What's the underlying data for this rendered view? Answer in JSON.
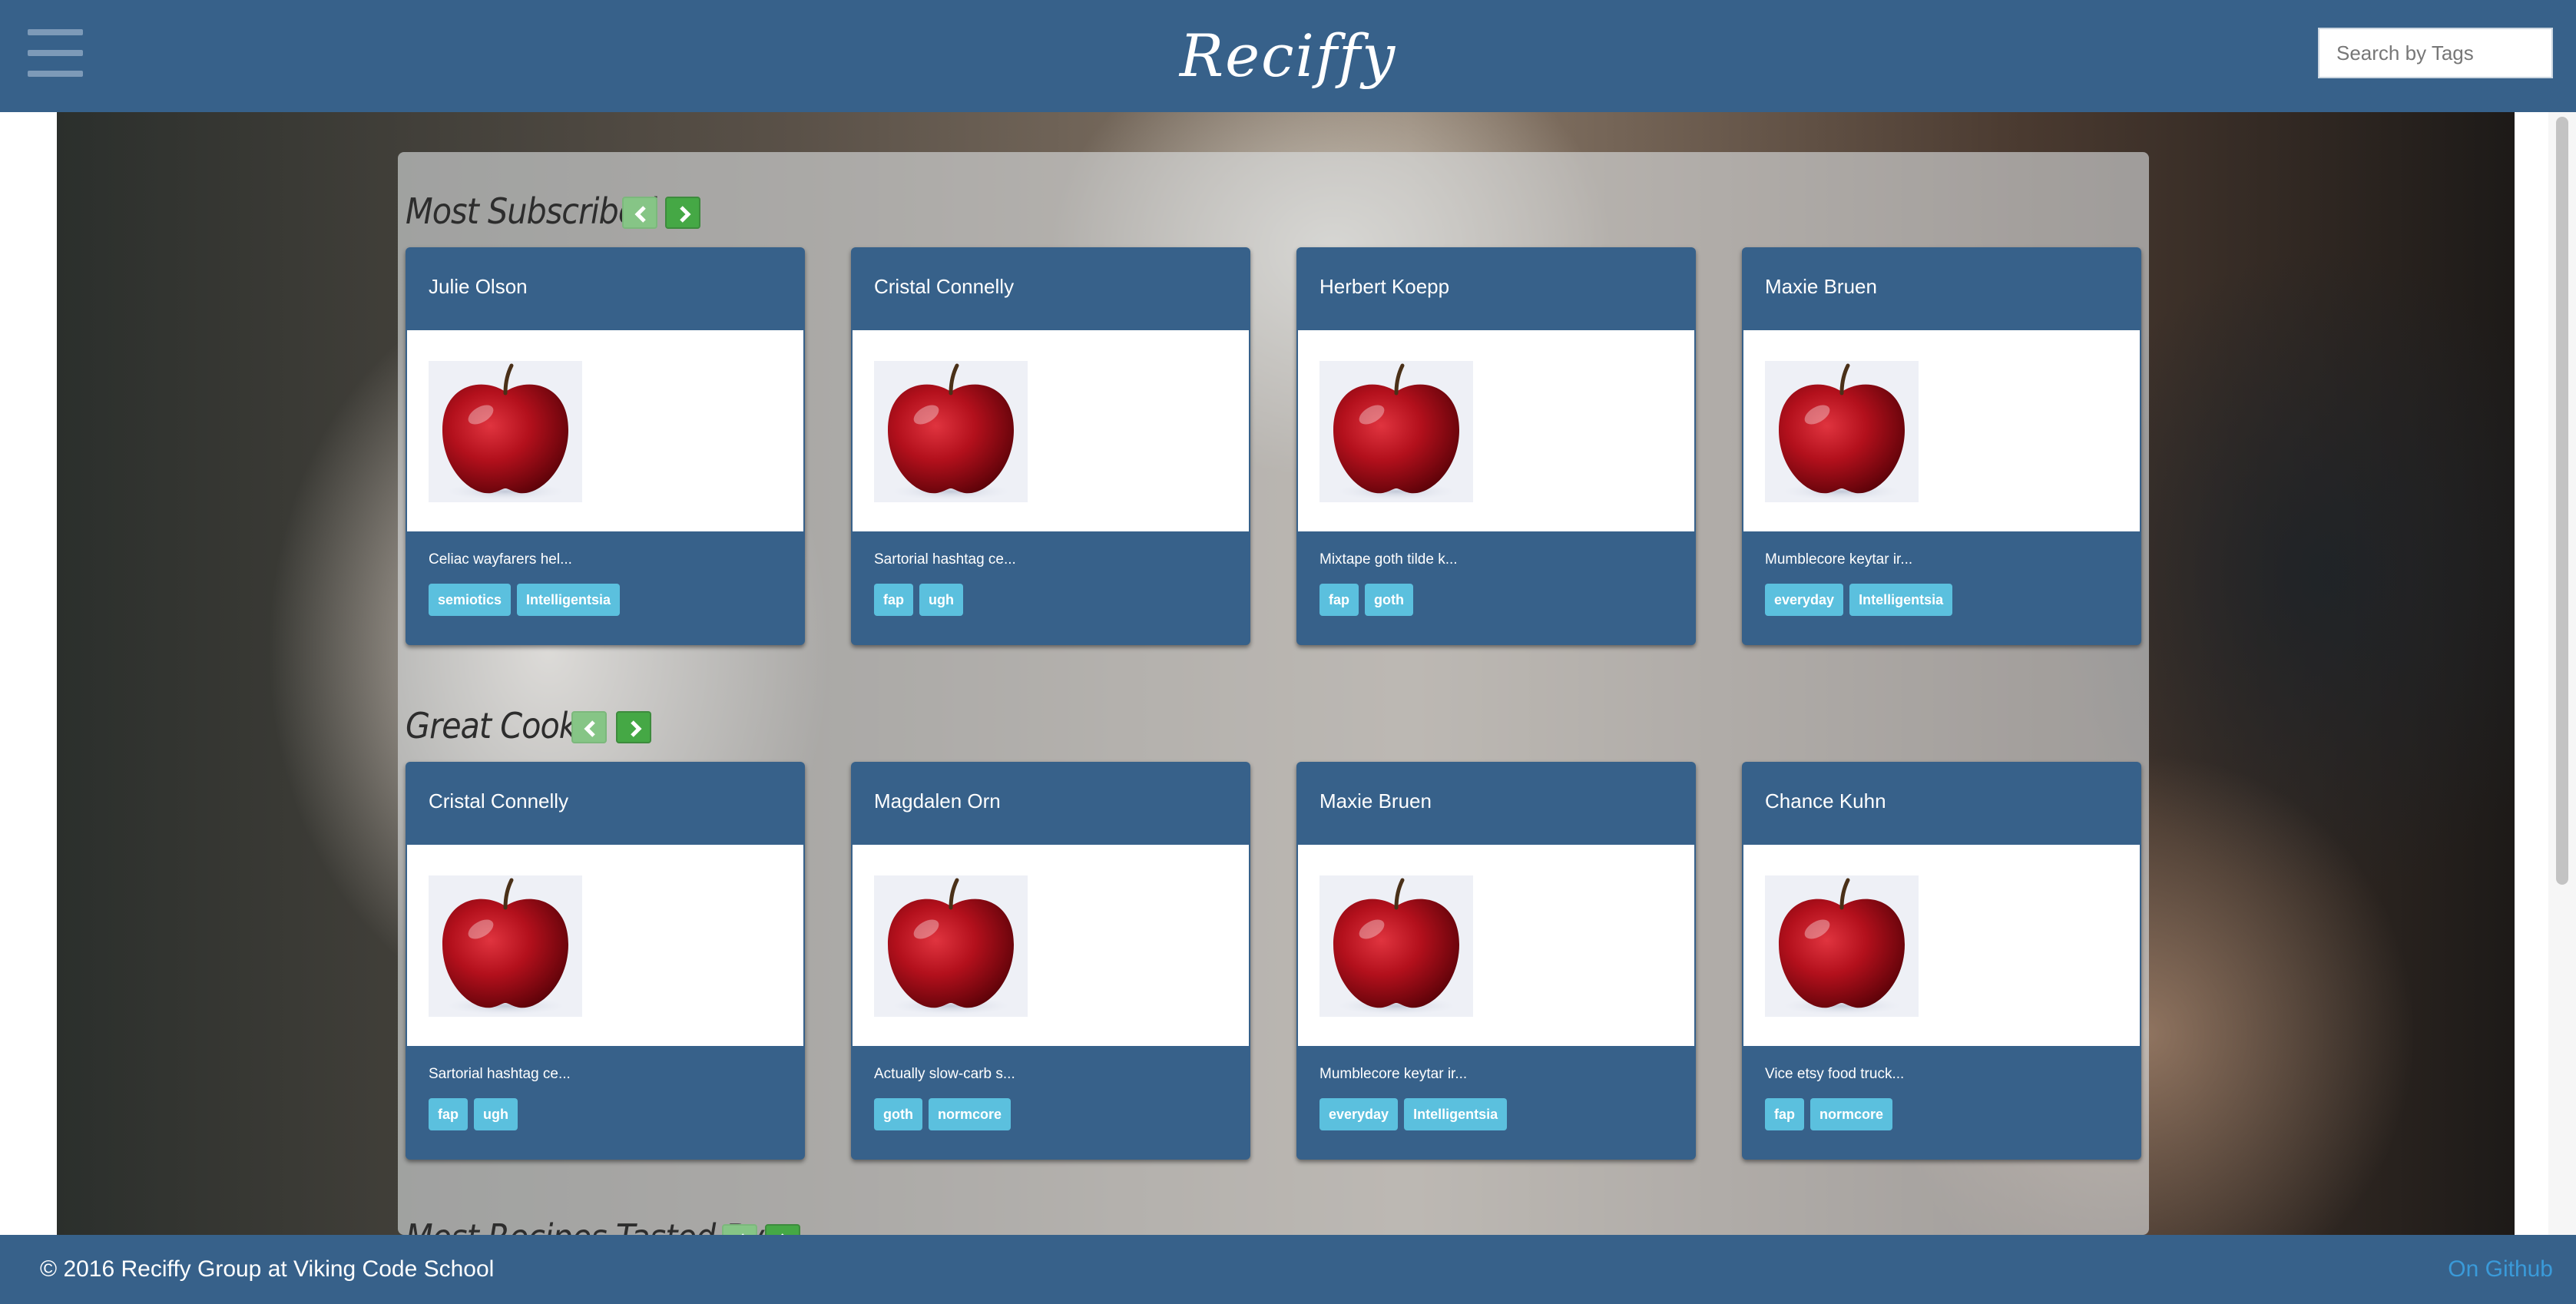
{
  "header": {
    "brand": "Reciffy",
    "search_placeholder": "Search by Tags"
  },
  "sections": [
    {
      "title": "Most Subscribed",
      "cards": [
        {
          "name": "Julie Olson",
          "description": "Celiac wayfarers hel...",
          "tags": [
            "semiotics",
            "Intelligentsia"
          ]
        },
        {
          "name": "Cristal Connelly",
          "description": "Sartorial hashtag ce...",
          "tags": [
            "fap",
            "ugh"
          ]
        },
        {
          "name": "Herbert Koepp",
          "description": "Mixtape goth tilde k...",
          "tags": [
            "fap",
            "goth"
          ]
        },
        {
          "name": "Maxie Bruen",
          "description": "Mumblecore keytar ir...",
          "tags": [
            "everyday",
            "Intelligentsia"
          ]
        }
      ]
    },
    {
      "title": "Great Cooks!",
      "cards": [
        {
          "name": "Cristal Connelly",
          "description": "Sartorial hashtag ce...",
          "tags": [
            "fap",
            "ugh"
          ]
        },
        {
          "name": "Magdalen Orn",
          "description": "Actually slow-carb s...",
          "tags": [
            "goth",
            "normcore"
          ]
        },
        {
          "name": "Maxie Bruen",
          "description": "Mumblecore keytar ir...",
          "tags": [
            "everyday",
            "Intelligentsia"
          ]
        },
        {
          "name": "Chance Kuhn",
          "description": "Vice etsy food truck...",
          "tags": [
            "fap",
            "normcore"
          ]
        }
      ]
    },
    {
      "title": "Most Recipes Tasted By"
    }
  ],
  "footer": {
    "copyright": "© 2016 Reciffy Group at Viking Code School",
    "github_link": "On Github"
  },
  "icons": {
    "menu": "hamburger-icon",
    "prev": "chevron-left-icon",
    "next": "chevron-right-icon",
    "card_image": "apple-icon"
  },
  "colors": {
    "navbar": "#37618a",
    "card": "#37618a",
    "tag": "#5bc0de",
    "next_button": "#45a845",
    "prev_button": "#86c586",
    "github_link": "#3a9ad9"
  }
}
